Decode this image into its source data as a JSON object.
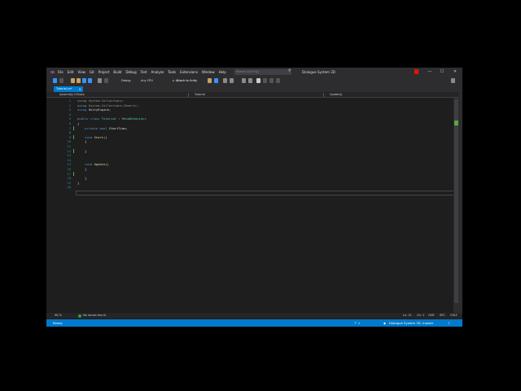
{
  "titlebar": {
    "menu": [
      "File",
      "Edit",
      "View",
      "Git",
      "Project",
      "Build",
      "Debug",
      "Test",
      "Analyze",
      "Tools",
      "Extensions",
      "Window",
      "Help"
    ],
    "search_placeholder": "Search (Ctrl+Q)",
    "project_name": "Dialogue System 3D",
    "minimize": "—",
    "restore": "☐",
    "close": "✕"
  },
  "toolbar": {
    "config": "Debug",
    "platform": "Any CPU",
    "attach": "Attach to Unity"
  },
  "tab": {
    "label": "Tutorial.cs*",
    "close": "×"
  },
  "navbar": {
    "project": "Assembly-CSharp",
    "class": "Tutorial",
    "member": "Update()"
  },
  "code_lines": [
    {
      "num": "1",
      "html": "<span class='d'>using</span> <span class='d'>System.Collections;</span>"
    },
    {
      "num": "2",
      "html": "<span class='d'>using</span> <span class='d'>System.Collections.Generic;</span>"
    },
    {
      "num": "3",
      "html": "<span class='k'>using</span> <span class='p'>UnityEngine;</span>"
    },
    {
      "num": "4",
      "html": ""
    },
    {
      "num": "5",
      "html": "<span class='k'>public</span> <span class='k'>class</span> <span class='t'>Tutorial</span> <span class='p'>:</span> <span class='t'>MonoBehaviour</span>"
    },
    {
      "num": "6",
      "html": "<span class='p'>{</span>"
    },
    {
      "num": "7",
      "html": "    <span class='k'>private</span> <span class='k'>bool</span> <span class='p'>StartTime;</span>"
    },
    {
      "num": "8",
      "html": ""
    },
    {
      "num": "9",
      "html": "    <span class='k'>void</span> <span class='n'>Start</span><span class='p'>()</span>"
    },
    {
      "num": "10",
      "html": "    <span class='p'>{</span>"
    },
    {
      "num": "11",
      "html": ""
    },
    {
      "num": "12",
      "html": "    <span class='p'>}</span>"
    },
    {
      "num": "13",
      "html": ""
    },
    {
      "num": "14",
      "html": ""
    },
    {
      "num": "15",
      "html": "    <span class='k'>void</span> <span class='n'>Update</span><span class='p'>()</span>"
    },
    {
      "num": "16",
      "html": "    <span class='p'>{</span>"
    },
    {
      "num": "17",
      "html": ""
    },
    {
      "num": "18",
      "html": "    <span class='p'>}</span>"
    },
    {
      "num": "19",
      "html": "<span class='p'>}</span>"
    },
    {
      "num": "20",
      "html": ""
    }
  ],
  "statusrow": {
    "zoom": "96 %",
    "issues": "No issues found",
    "line": "Ln: 21",
    "col": "Ch: 1",
    "mode": "OVR",
    "enc": "SPC",
    "eol": "CRLF"
  },
  "statusbar": {
    "state": "Ready",
    "branch": "Dialogue System 3D",
    "master": "master"
  },
  "colors": {
    "accent": "#007acc",
    "chrome": "#2d2d30",
    "editor_bg": "#1e1e1e"
  }
}
